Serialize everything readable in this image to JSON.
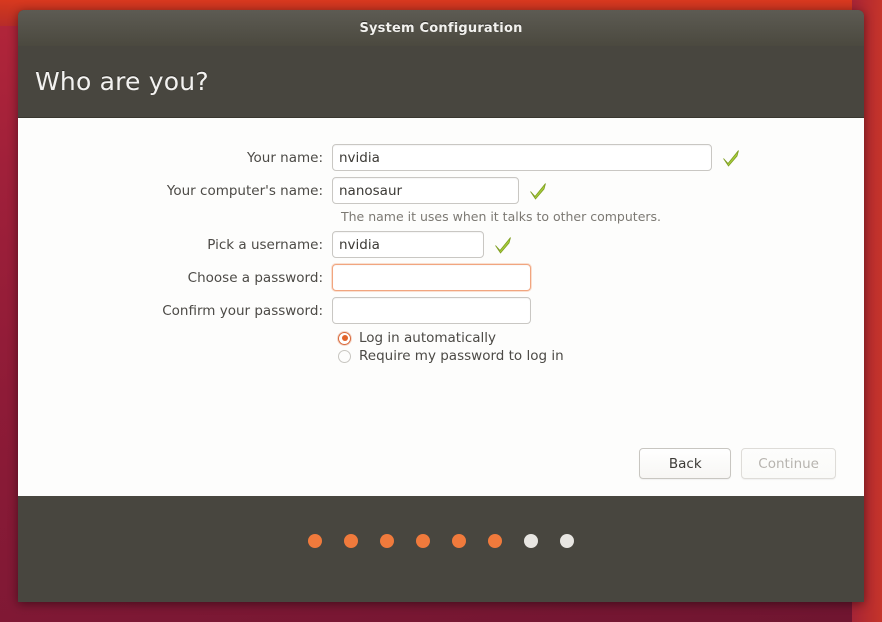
{
  "window": {
    "titlebar_title": "System Configuration",
    "header_title": "Who are you?"
  },
  "form": {
    "fields": [
      {
        "label": "Your name:",
        "value": "nvidia",
        "placeholder": "",
        "validated": true,
        "focused": false,
        "width": "w-wide",
        "name": "your-name"
      },
      {
        "label": "Your computer's name:",
        "value": "nanosaur",
        "placeholder": "",
        "validated": true,
        "focused": false,
        "width": "w-medium",
        "name": "computer-name"
      },
      {
        "label": "Pick a username:",
        "value": "nvidia",
        "placeholder": "",
        "validated": true,
        "focused": false,
        "width": "w-small",
        "name": "username"
      },
      {
        "label": "Choose a password:",
        "value": "",
        "placeholder": "",
        "validated": false,
        "focused": true,
        "width": "w-pass",
        "name": "password"
      },
      {
        "label": "Confirm your password:",
        "value": "",
        "placeholder": "",
        "validated": false,
        "focused": false,
        "width": "w-pass",
        "name": "confirm-password"
      }
    ],
    "computer_name_hint": "The name it uses when it talks to other computers.",
    "login_options": [
      {
        "label": "Log in automatically",
        "selected": true
      },
      {
        "label": "Require my password to log in",
        "selected": false
      }
    ]
  },
  "buttons": {
    "back_label": "Back",
    "continue_label": "Continue",
    "continue_disabled": true
  },
  "progress": {
    "total_steps": 8,
    "completed_steps": 6,
    "dots": [
      "done",
      "done",
      "done",
      "done",
      "done",
      "done",
      "pending",
      "pending"
    ]
  },
  "colors": {
    "accent_orange": "#e2642b",
    "progress_done": "#f07a3c",
    "progress_pending": "#e8e6e2",
    "window_chrome": "#48463f",
    "check_green": "#9ac23a",
    "desktop_red": "#a0203a"
  },
  "icons": {
    "valid_check": "check-icon"
  }
}
